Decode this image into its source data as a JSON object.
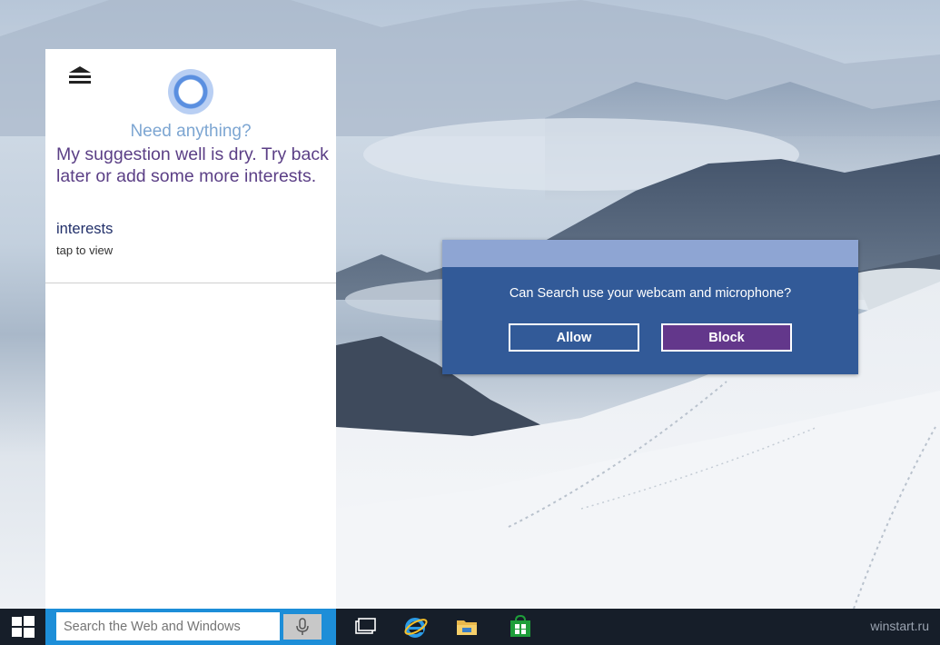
{
  "cortana": {
    "greeting": "Need anything?",
    "suggestion": "My suggestion well is dry. Try back later or add some more interests.",
    "interests_link": "interests",
    "interests_hint": "tap to view"
  },
  "dialog": {
    "question": "Can Search use your webcam and microphone?",
    "allow_label": "Allow",
    "block_label": "Block"
  },
  "taskbar": {
    "search_placeholder": "Search the Web and Windows",
    "watermark": "winstart.ru",
    "icons": [
      "windows-logo-icon",
      "microphone-icon",
      "task-view-icon",
      "internet-explorer-icon",
      "file-explorer-icon",
      "windows-store-icon"
    ]
  },
  "colors": {
    "accent_blue": "#1d8ed8",
    "dialog_blue": "#325a98",
    "block_purple": "#63378b",
    "suggestion_purple": "#5b3f86",
    "taskbar": "#161e29"
  }
}
